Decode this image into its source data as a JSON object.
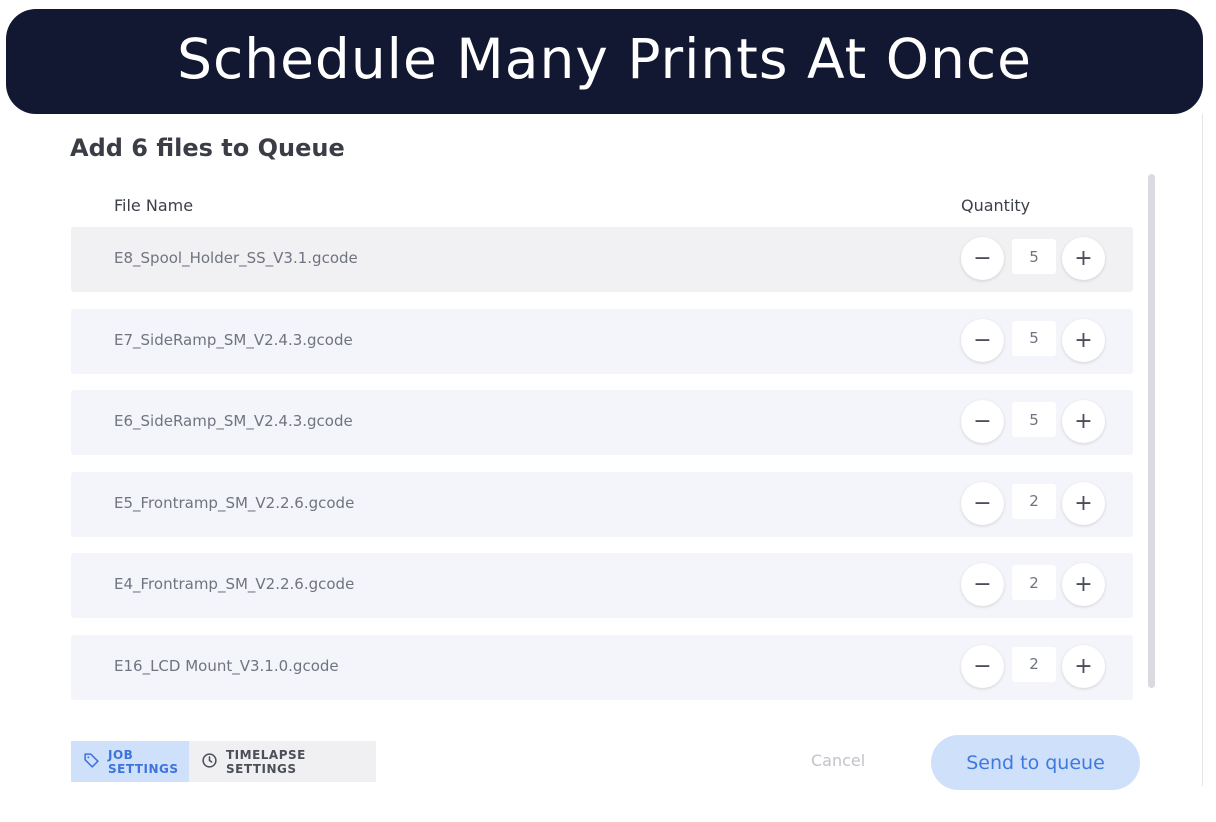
{
  "banner": {
    "title": "Schedule Many Prints At Once"
  },
  "dialog": {
    "title": "Add 6 files to Queue",
    "columns": {
      "file_name": "File Name",
      "quantity": "Quantity"
    },
    "rows": [
      {
        "file_name": "E8_Spool_Holder_SS_V3.1.gcode",
        "quantity": "5"
      },
      {
        "file_name": "E7_SideRamp_SM_V2.4.3.gcode",
        "quantity": "5"
      },
      {
        "file_name": "E6_SideRamp_SM_V2.4.3.gcode",
        "quantity": "5"
      },
      {
        "file_name": "E5_Frontramp_SM_V2.2.6.gcode",
        "quantity": "2"
      },
      {
        "file_name": "E4_Frontramp_SM_V2.2.6.gcode",
        "quantity": "2"
      },
      {
        "file_name": "E16_LCD Mount_V3.1.0.gcode",
        "quantity": "2"
      }
    ],
    "stepper": {
      "minus_symbol": "−",
      "plus_symbol": "+"
    }
  },
  "footer": {
    "tabs": [
      {
        "label": "JOB SETTINGS",
        "icon": "tag-icon",
        "active": true
      },
      {
        "label": "TIMELAPSE SETTINGS",
        "icon": "clock-icon",
        "active": false
      }
    ],
    "cancel_label": "Cancel",
    "send_label": "Send to queue"
  },
  "colors": {
    "banner_bg": "#121831",
    "accent": "#3f79df",
    "accent_light": "#cfe0fb",
    "row_bg": "#f4f5fa"
  }
}
